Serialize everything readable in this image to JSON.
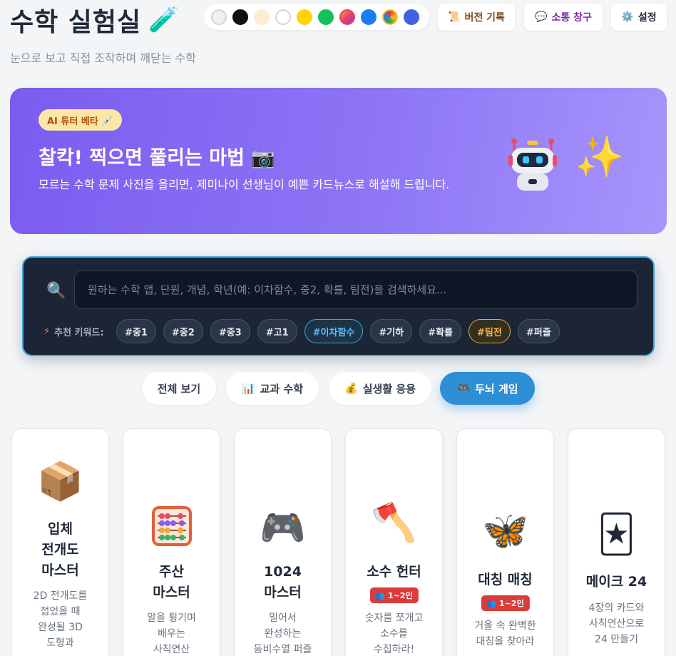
{
  "header": {
    "title": "수학 실험실",
    "title_icon": "test-tube-icon",
    "subtitle": "눈으로 보고 직접 조작하며 깨닫는 수학",
    "palette": [
      {
        "name": "light-gray",
        "color": "#eef0f2"
      },
      {
        "name": "black",
        "color": "#111111"
      },
      {
        "name": "cream",
        "color": "#fdebd3"
      },
      {
        "name": "white",
        "color": "#ffffff"
      },
      {
        "name": "yellow",
        "color": "#ffd400"
      },
      {
        "name": "green",
        "color": "#12c15d"
      },
      {
        "name": "gradient-pink",
        "color": "#e8406a"
      },
      {
        "name": "blue",
        "color": "#1a7ef2"
      },
      {
        "name": "multicolor",
        "color": "#e53935"
      },
      {
        "name": "royal-blue",
        "color": "#3f63e0"
      }
    ],
    "buttons": {
      "version": "버전 기록",
      "version_icon": "scroll-icon",
      "communication": "소통 창구",
      "communication_icon": "speech-bubble-icon",
      "settings": "설정",
      "settings_icon": "gear-icon"
    }
  },
  "banner": {
    "badge": "AI 튜터 베타 💉",
    "title": "찰칵! 찍으면 풀리는 마법 📷",
    "description": "모르는 수학 문제 사진을 올리면, 제미나이 선생님이 예쁜 카드뉴스로 해설해 드립니다.",
    "robot_icon": "robot-icon",
    "sparkle_icon": "sparkles-icon"
  },
  "search": {
    "placeholder": "원하는 수학 앱, 단원, 개념, 학년(예: 이차함수, 중2, 확률, 팀전)을 검색하세요...",
    "keywords_label": "추천 키워드:",
    "keywords": [
      "#중1",
      "#중2",
      "#중3",
      "#고1",
      "#이차함수",
      "#기하",
      "#확률",
      "#팀전",
      "#퍼즐"
    ]
  },
  "tabs": [
    {
      "label": "전체 보기",
      "icon": ""
    },
    {
      "label": "교과 수학",
      "icon": "📊"
    },
    {
      "label": "실생활 응용",
      "icon": "💰"
    },
    {
      "label": "두뇌 게임",
      "icon": "🎮",
      "active": true
    }
  ],
  "cards": [
    {
      "icon": "📦",
      "title": "입체\n전개도\n마스터",
      "desc": "2D 전개도를\n접었을 때\n완성될 3D\n도형과"
    },
    {
      "icon": "🧮",
      "title": "주산\n마스터",
      "desc": "알을 튕기며\n배우는\n사칙연산"
    },
    {
      "icon": "🎮",
      "title": "1024\n마스터",
      "desc": "밀어서\n완성하는\n등비수열 퍼즐"
    },
    {
      "icon": "🪓",
      "title": "소수 헌터",
      "badge": "👥 1~2인",
      "desc": "숫자를 쪼개고\n소수를\n수집하라!"
    },
    {
      "icon": "🦋",
      "title": "대칭 매칭",
      "badge": "👥 1~2인",
      "desc": "거울 속 완벽한\n대칭을 찾아라"
    },
    {
      "icon": "🃏",
      "title": "메이크 24",
      "desc": "4장의 카드와\n사칙연산으로\n24 만들기"
    }
  ]
}
